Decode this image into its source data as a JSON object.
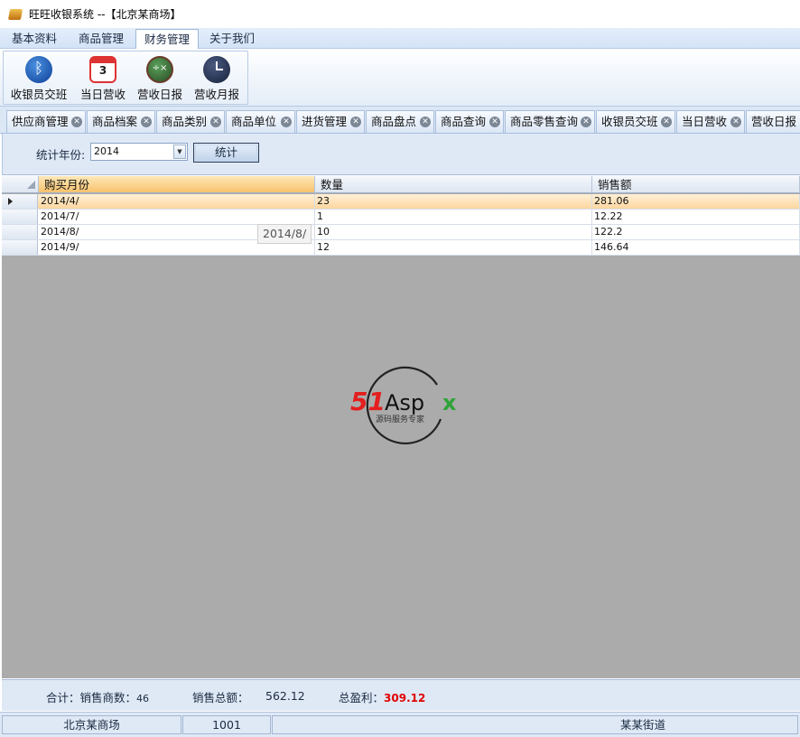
{
  "window": {
    "title": "旺旺收银系统 --【北京某商场】"
  },
  "menu": [
    "基本资料",
    "商品管理",
    "财务管理",
    "关于我们"
  ],
  "menu_active": "财务管理",
  "ribbon": [
    {
      "label": "收银员交班",
      "icon": "bluetooth-icon"
    },
    {
      "label": "当日营收",
      "icon": "calendar-icon"
    },
    {
      "label": "营收日报",
      "icon": "calculator-icon"
    },
    {
      "label": "营收月报",
      "icon": "clock-icon"
    }
  ],
  "doc_tabs": [
    "供应商管理",
    "商品档案",
    "商品类别",
    "商品单位",
    "进货管理",
    "商品盘点",
    "商品查询",
    "商品零售查询",
    "收银员交班",
    "当日营收",
    "营收日报"
  ],
  "filter": {
    "label": "统计年份:",
    "year": "2014",
    "button": "统计"
  },
  "grid": {
    "columns": [
      "购买月份",
      "数量",
      "销售额"
    ],
    "rows": [
      {
        "month": "2014/4/",
        "qty": "23",
        "sales": "281.06"
      },
      {
        "month": "2014/7/",
        "qty": "1",
        "sales": "12.22"
      },
      {
        "month": "2014/8/",
        "qty": "10",
        "sales": "122.2"
      },
      {
        "month": "2014/9/",
        "qty": "12",
        "sales": "146.64"
      }
    ],
    "tooltip": "2014/8/"
  },
  "watermark": {
    "brand_51": "51",
    "brand_aspx": "Asp",
    "brand_x": "x",
    "tagline": "源码服务专家"
  },
  "summary": {
    "items_label": "合计：销售商数：",
    "items_value": "46",
    "total_label": "销售总额：",
    "total_value": "562.12",
    "profit_label": "总盈利：",
    "profit_value": "309.12"
  },
  "status": {
    "store": "北京某商场",
    "code": "1001",
    "address": "某某街道"
  }
}
